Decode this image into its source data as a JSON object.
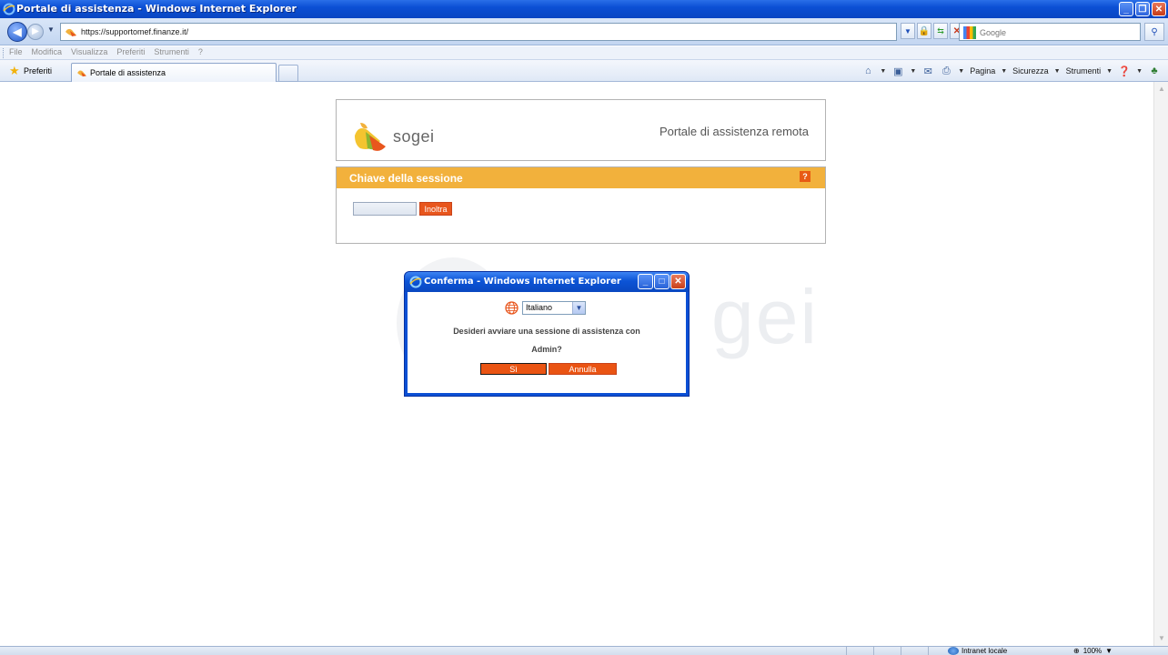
{
  "window": {
    "title": "Portale di assistenza - Windows Internet Explorer"
  },
  "address": {
    "url": "https://supportomef.finanze.it/",
    "search_placeholder": "Google"
  },
  "menu": {
    "items": [
      "File",
      "Modifica",
      "Visualizza",
      "Preferiti",
      "Strumenti",
      "?"
    ]
  },
  "favorites": {
    "label": "Preferiti",
    "tab_label": "Portale di assistenza"
  },
  "command_bar": {
    "pagina": "Pagina",
    "sicurezza": "Sicurezza",
    "strumenti": "Strumenti"
  },
  "page": {
    "logo_text": "sogei",
    "portal_title": "Portale di assistenza remota",
    "session_title": "Chiave della sessione",
    "help_label": "?",
    "session_input_value": "",
    "submit_label": "Inoltra",
    "watermark_text": "gei"
  },
  "dialog": {
    "title": "Conferma - Windows Internet Explorer",
    "language_value": "Italiano",
    "message_line1": "Desideri avviare una sessione di assistenza con",
    "message_line2": "Admin?",
    "yes_label": "Sì",
    "cancel_label": "Annulla"
  },
  "statusbar": {
    "zone": "Intranet locale",
    "zoom": "100%"
  },
  "colors": {
    "accent_orange": "#f2b13c",
    "button_orange": "#ea5413",
    "xp_blue": "#0b4fd4"
  }
}
